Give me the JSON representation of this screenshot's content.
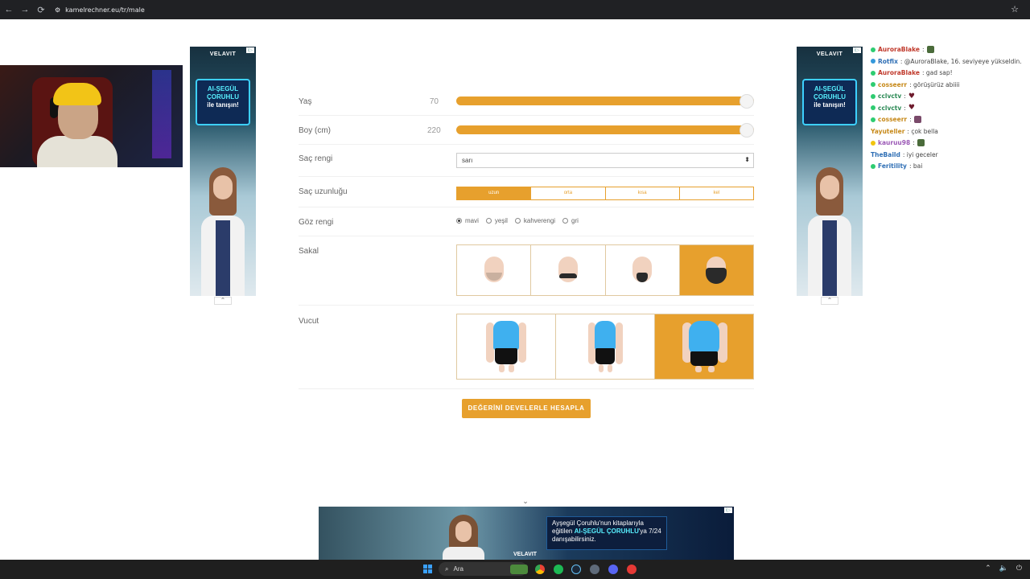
{
  "browser": {
    "url": "kamelrechner.eu/tr/male",
    "back": "←",
    "forward": "→",
    "reload": "⟳",
    "star": "☆"
  },
  "ads": {
    "left": {
      "brand": "VELAVIT",
      "line1": "AI-ŞEGÜL",
      "line2": "ÇORUHLU",
      "line3": "ile tanışın!",
      "badge": "i▷",
      "arrow": "⌃"
    },
    "right": {
      "brand": "VELAVIT",
      "line1": "AI-ŞEGÜL",
      "line2": "ÇORUHLU",
      "line3": "ile tanışın!",
      "badge": "i▷",
      "arrow": "⌃"
    },
    "bottom": {
      "text1": "Ayşegül Çoruhlu'nun kitaplarıyla eğitilen ",
      "highlight": "AI-ŞEGÜL ÇORUHLU",
      "text2": "'ya 7/24 danışabilirsiniz.",
      "brand": "VELAVIT",
      "badge": "i▷",
      "collapse": "⌄"
    }
  },
  "form": {
    "age": {
      "label": "Yaş",
      "value": "70",
      "fill": 1.0
    },
    "height": {
      "label": "Boy (cm)",
      "value": "220",
      "fill": 1.0
    },
    "hair_color": {
      "label": "Saç rengi",
      "selected": "sarı",
      "caret": "⬍"
    },
    "hair_length": {
      "label": "Saç uzunluğu",
      "options": [
        "uzun",
        "orta",
        "kısa",
        "kel"
      ],
      "selected_index": 0
    },
    "eye_color": {
      "label": "Göz rengi",
      "options": [
        "mavi",
        "yeşil",
        "kahverengi",
        "gri"
      ],
      "selected_index": 0
    },
    "beard": {
      "label": "Sakal",
      "options": [
        "stubble-icon",
        "mustache-icon",
        "goatee-icon",
        "full-beard-icon"
      ],
      "selected_index": 3
    },
    "body": {
      "label": "Vucut",
      "options": [
        "slim-body-icon",
        "average-body-icon",
        "heavy-body-icon"
      ],
      "selected_index": 2
    },
    "submit_label": "DEĞERİNİ DEVELERLE HESAPLA"
  },
  "chat": [
    {
      "user": "AuroraBlake",
      "user_color": "#c0392b",
      "text": ":",
      "emote": true
    },
    {
      "user": "Rotfix",
      "user_color": "#2f6fb5",
      "text": ": @AuroraBlake, 16. seviyeye yükseldin."
    },
    {
      "user": "AuroraBlake",
      "user_color": "#c0392b",
      "text": ": gad sap!"
    },
    {
      "user": "cosseerr",
      "user_color": "#c78a1b",
      "text": ": görüşürüz abiiii"
    },
    {
      "user": "cclvctv",
      "user_color": "#2e8b57",
      "text": ":",
      "heart": "♥"
    },
    {
      "user": "cclvctv",
      "user_color": "#2e8b57",
      "text": ":",
      "heart": "♥"
    },
    {
      "user": "cosseerr",
      "user_color": "#c78a1b",
      "text": ":",
      "emote": true
    },
    {
      "user": "Yayuteller",
      "user_color": "#c78a1b",
      "text": ": çok bella"
    },
    {
      "user": "kauruu98",
      "user_color": "#9b59b6",
      "text": ":",
      "emote": true
    },
    {
      "user": "TheBaild",
      "user_color": "#2f6fb5",
      "text": ": iyi geceler"
    },
    {
      "user": "Feritility",
      "user_color": "#2f6fb5",
      "text": ": bai"
    }
  ],
  "taskbar": {
    "search_placeholder": "Ara",
    "search_icon": "⌕",
    "tray": [
      "⌃",
      "🔈",
      "⏻"
    ]
  }
}
